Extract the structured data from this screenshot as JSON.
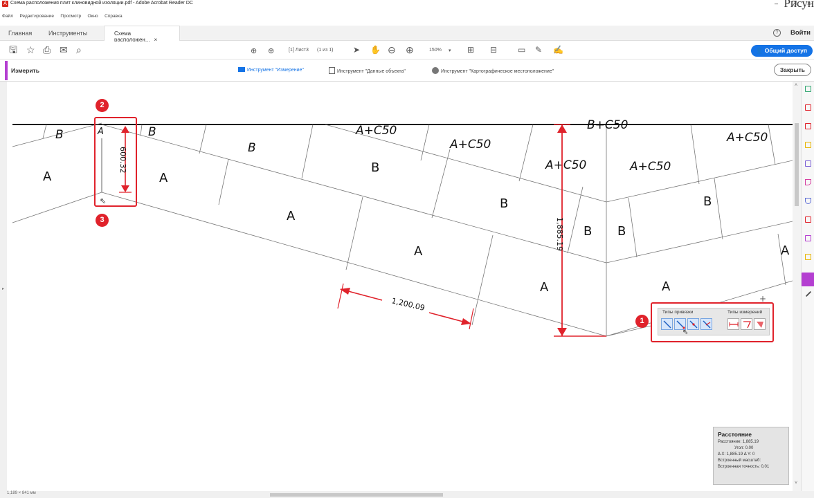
{
  "window": {
    "title": "Схема расположения плит клиновидной изоляции.pdf - Adobe Acrobat Reader DC",
    "corner_text": "Рисун",
    "minimize": "–",
    "maximize": "❐",
    "close": "×"
  },
  "menu": [
    "Файл",
    "Редактирование",
    "Просмотр",
    "Окно",
    "Справка"
  ],
  "tabs": {
    "home": "Главная",
    "tools": "Инструменты",
    "document": "Схема расположен...",
    "close": "×"
  },
  "header_right": {
    "help": "?",
    "login": "Войти"
  },
  "toolbar": {
    "page_field": "[1] Лист3",
    "page_count": "(1 из 1)",
    "zoom": "150%",
    "share_label": "Общий доступ"
  },
  "measure_bar": {
    "label": "Измерить",
    "tool_measure": "Инструмент \"Измерение\"",
    "tool_object_data": "Инструмент \"Данные объекта\"",
    "tool_geo": "Инструмент \"Картографическое местоположение\"",
    "close_label": "Закрыть"
  },
  "drawing": {
    "labels_upper": [
      "B",
      "A",
      "B",
      "B",
      "A+C50",
      "A+C50",
      "B+C50",
      "A+C50",
      "A+C50",
      "A+C50"
    ],
    "labels_mid": [
      "A",
      "A",
      "B",
      "B",
      "B",
      "B",
      "B"
    ],
    "labels_lower": [
      "A",
      "A",
      "A",
      "A",
      "A"
    ],
    "dim_vertical_small": "600.32",
    "dim_vertical_large": "1,885.19",
    "dim_horizontal": "1,200.09"
  },
  "badges": [
    "1",
    "2",
    "3"
  ],
  "snap_popup": {
    "snap_types_title": "Типы привязки",
    "measure_types_title": "Типы измерений"
  },
  "info_panel": {
    "title": "Расстояние",
    "distance": "Расстояние: 1,885.19",
    "angle": "Угол: 0.00",
    "delta": "Δ X: 1,885.19     Δ Y: 0",
    "scale": "Встроенный масштаб:",
    "precision": "Встроенная точность:  0,01"
  },
  "status": {
    "page_size": "1,189 × 841 мм"
  }
}
